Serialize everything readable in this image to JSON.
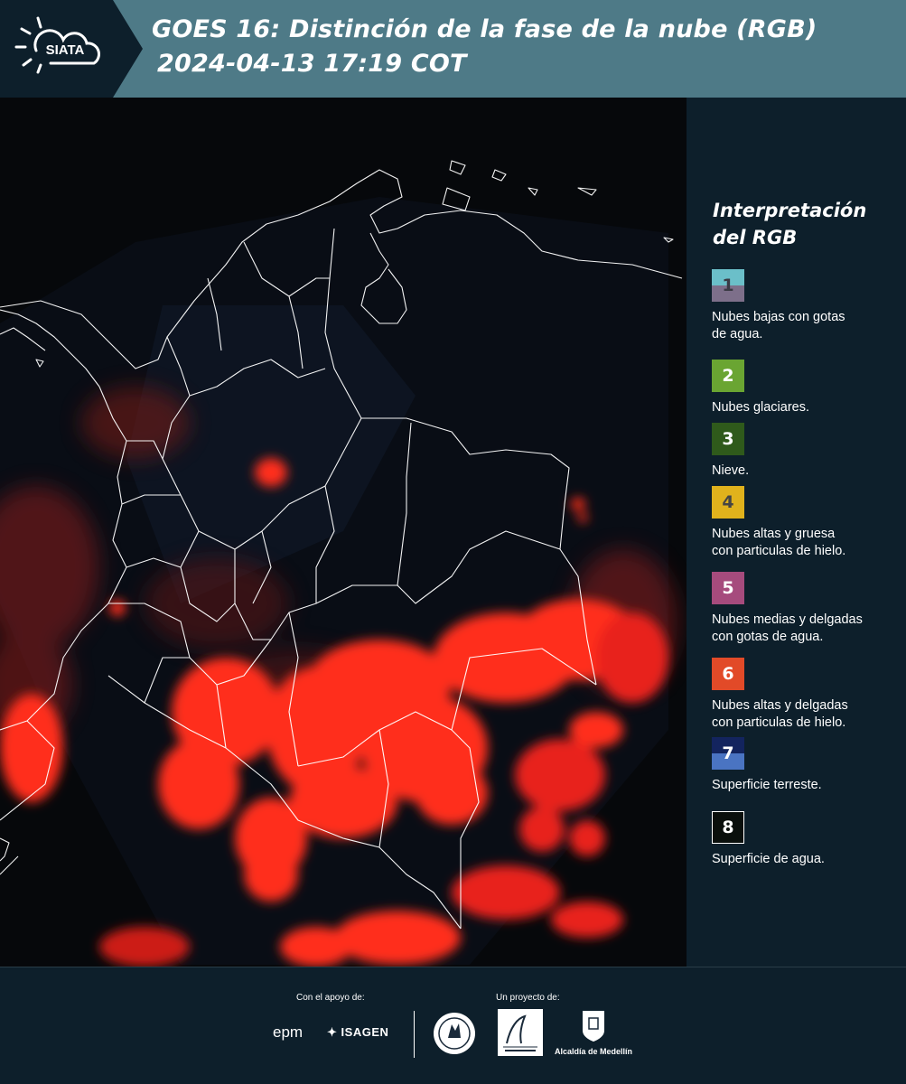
{
  "header": {
    "logo_text": "SIATA",
    "title_line1": "GOES 16: Distinción de la fase de la nube (RGB)",
    "title_line2": "2024-04-13 17:19 COT"
  },
  "legend": {
    "title_line1": "Interpretación",
    "title_line2": "del RGB",
    "items": [
      {
        "number": "1",
        "label_lines": [
          "Nubes bajas con gotas",
          "de agua."
        ],
        "colors": [
          "#6bbfc9",
          "#7d6f8a"
        ],
        "text_color": "#3a3a44"
      },
      {
        "number": "2",
        "label_lines": [
          "Nubes glaciares."
        ],
        "colors": [
          "#6aa532"
        ],
        "text_color": "#ffffff"
      },
      {
        "number": "3",
        "label_lines": [
          "Nieve."
        ],
        "colors": [
          "#2f5a1b"
        ],
        "text_color": "#ffffff"
      },
      {
        "number": "4",
        "label_lines": [
          "Nubes altas y gruesa",
          "con particulas de hielo."
        ],
        "colors": [
          "#e0b21c"
        ],
        "text_color": "#444444"
      },
      {
        "number": "5",
        "label_lines": [
          "Nubes medias y delgadas",
          "con gotas de agua."
        ],
        "colors": [
          "#a64b7d"
        ],
        "text_color": "#ffffff"
      },
      {
        "number": "6",
        "label_lines": [
          "Nubes altas y delgadas",
          "con particulas de hielo."
        ],
        "colors": [
          "#e24a28"
        ],
        "text_color": "#ffffff"
      },
      {
        "number": "7",
        "label_lines": [
          "Superficie terreste."
        ],
        "colors": [
          "#13245e",
          "#4a74c2"
        ],
        "text_color": "#ffffff"
      },
      {
        "number": "8",
        "label_lines": [
          "Superficie de agua."
        ],
        "colors": [
          "#0a0f0c"
        ],
        "text_color": "#ffffff"
      }
    ]
  },
  "footer": {
    "support_caption": "Con el apoyo de:",
    "project_caption": "Un proyecto de:",
    "sponsor_epm": "epm",
    "sponsor_isagen": "ISAGEN",
    "alcaldia": "Alcaldía de Medellín"
  },
  "colors": {
    "header_bg": "#4e7a87",
    "panel_bg": "#0d1f2b",
    "cloud_red": "#ff2a1a",
    "boundary": "#ffffff"
  }
}
